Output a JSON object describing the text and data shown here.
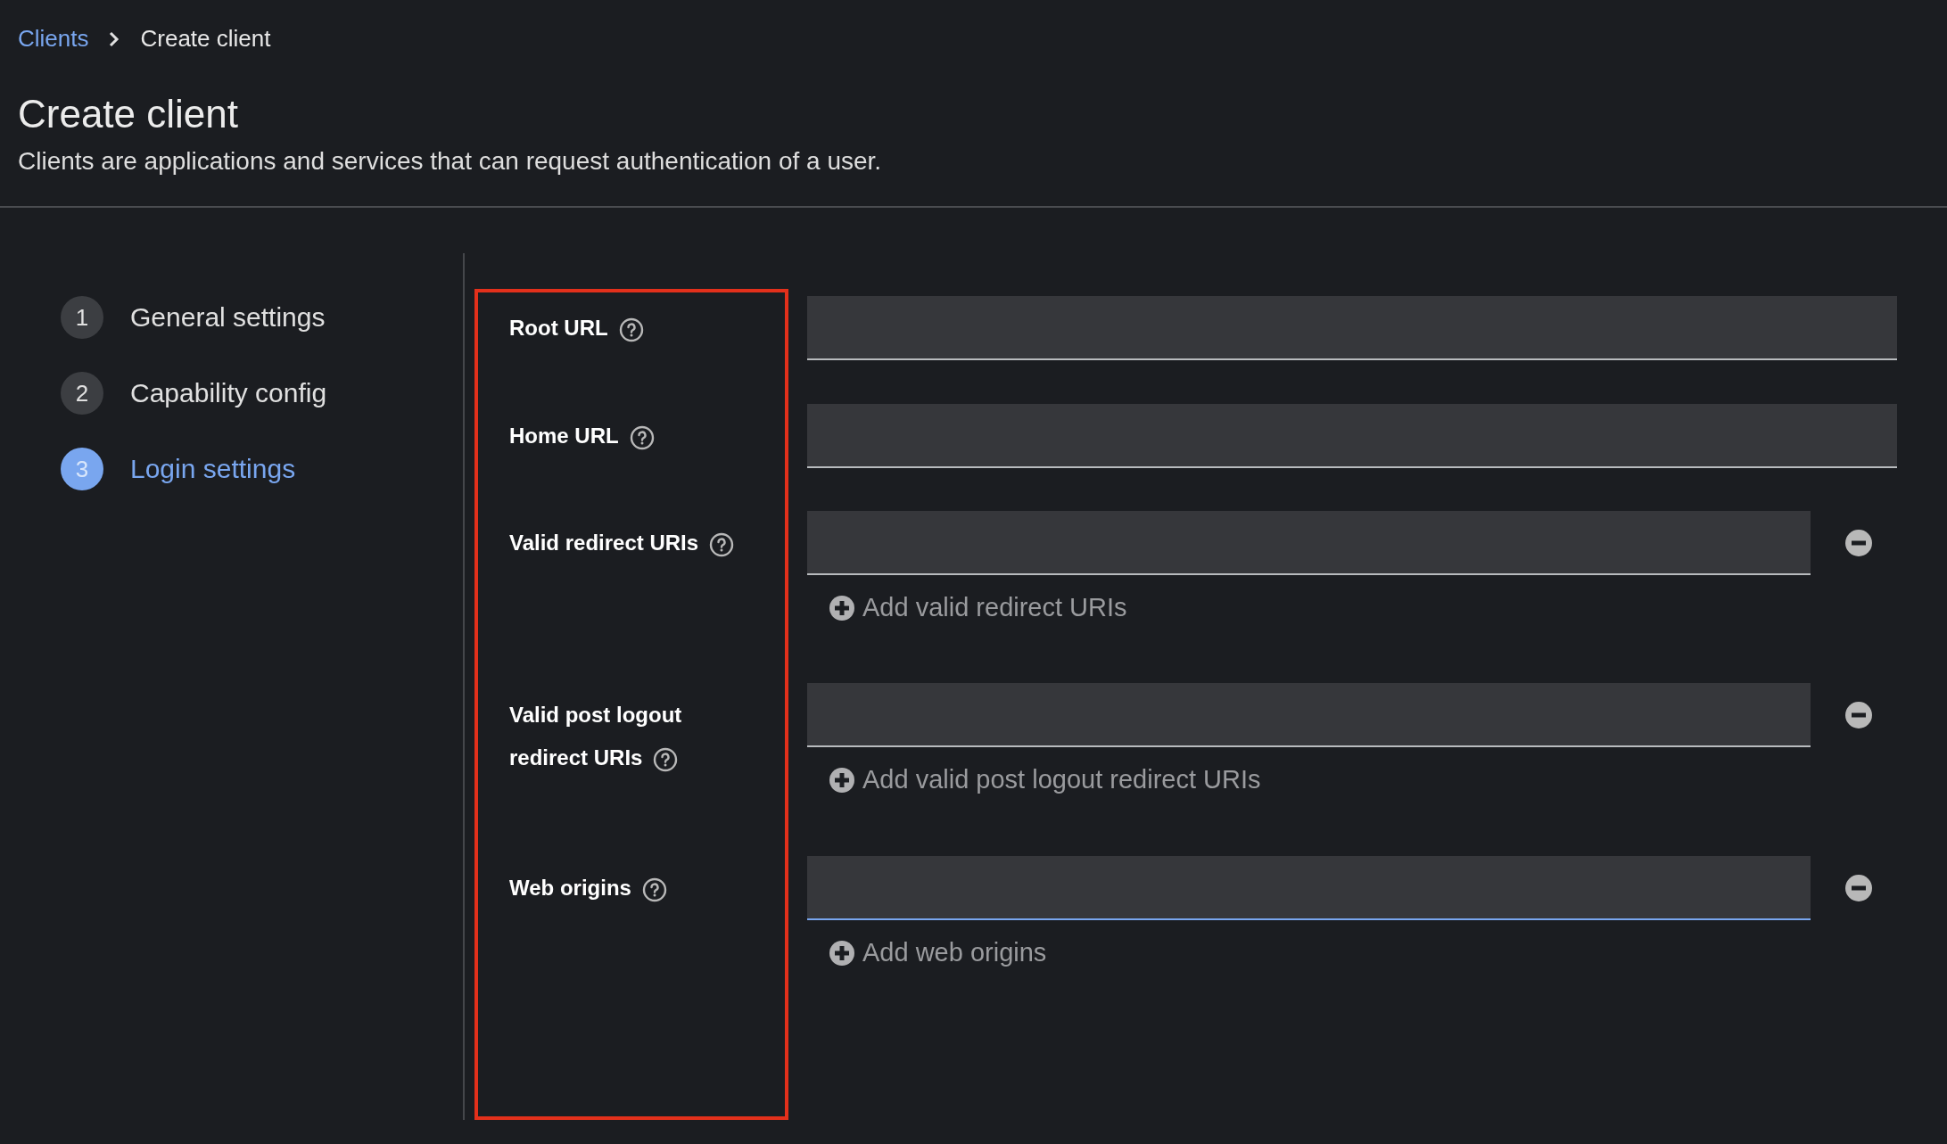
{
  "breadcrumb": {
    "items": [
      {
        "label": "Clients",
        "kind": "link"
      },
      {
        "label": "Create client",
        "kind": "current"
      }
    ]
  },
  "page": {
    "title": "Create client",
    "description": "Clients are applications and services that can request authentication of a user."
  },
  "steps": [
    {
      "number": "1",
      "label": "General settings",
      "selected": false
    },
    {
      "number": "2",
      "label": "Capability config",
      "selected": false
    },
    {
      "number": "3",
      "label": "Login settings",
      "selected": true
    }
  ],
  "fields": [
    {
      "kind": "text",
      "label": "Root URL",
      "focused": false
    },
    {
      "kind": "text",
      "label": "Home URL",
      "focused": false
    },
    {
      "kind": "list",
      "label": "Valid redirect URIs",
      "add_label": "Add valid redirect URIs",
      "focused": false
    },
    {
      "kind": "list",
      "label": "Valid post logout redirect URIs",
      "add_label": "Add valid post logout redirect URIs",
      "focused": false
    },
    {
      "kind": "list",
      "label": "Web origins",
      "add_label": "Add web origins",
      "focused": true
    }
  ]
}
